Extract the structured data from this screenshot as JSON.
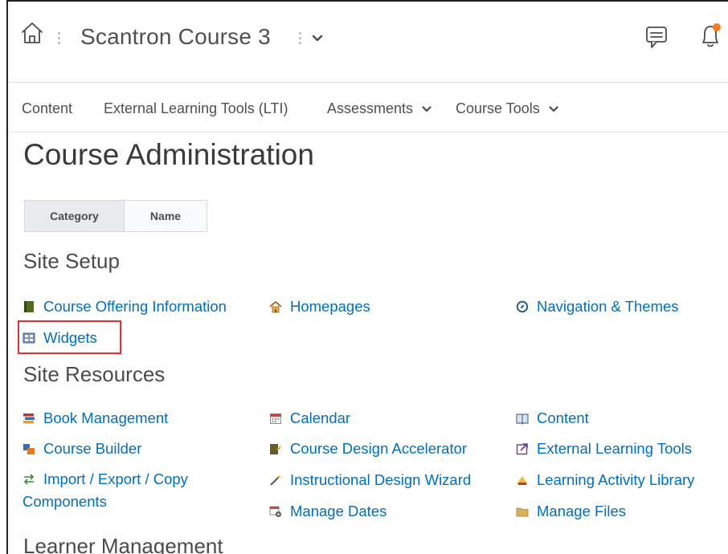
{
  "header": {
    "course_title": "Scantron Course 3"
  },
  "nav": {
    "items": [
      {
        "label": "Content"
      },
      {
        "label": "External Learning Tools (LTI)"
      },
      {
        "label": "Assessments"
      },
      {
        "label": "Course Tools"
      }
    ]
  },
  "page": {
    "title": "Course Administration"
  },
  "view_toggle": {
    "options": [
      "Category",
      "Name"
    ],
    "selected": "Category"
  },
  "sections": [
    {
      "title": "Site Setup",
      "tools": [
        {
          "label": "Course Offering Information",
          "icon": "book-icon"
        },
        {
          "label": "Homepages",
          "icon": "house-icon"
        },
        {
          "label": "Navigation & Themes",
          "icon": "compass-icon"
        },
        {
          "label": "Widgets",
          "icon": "widget-grid-icon"
        }
      ]
    },
    {
      "title": "Site Resources",
      "tools": [
        {
          "label": "Book Management",
          "icon": "books-icon"
        },
        {
          "label": "Calendar",
          "icon": "calendar-icon"
        },
        {
          "label": "Content",
          "icon": "open-book-icon"
        },
        {
          "label": "Course Builder",
          "icon": "blocks-icon"
        },
        {
          "label": "Course Design Accelerator",
          "icon": "accelerator-icon"
        },
        {
          "label": "External Learning Tools",
          "icon": "external-tool-icon"
        },
        {
          "label": "Import / Export / Copy Components",
          "icon": "arrows-icon"
        },
        {
          "label": "Instructional Design Wizard",
          "icon": "wand-icon"
        },
        {
          "label": "Learning Activity Library",
          "icon": "library-icon"
        },
        {
          "label": "Manage Dates",
          "icon": "dates-gear-icon"
        },
        {
          "label": "Manage Files",
          "icon": "folder-icon"
        }
      ]
    },
    {
      "title": "Learner Management",
      "tools": []
    }
  ],
  "colors": {
    "link": "#006fbf",
    "highlight_box": "#e03131",
    "notification_dot": "#f47b20"
  }
}
